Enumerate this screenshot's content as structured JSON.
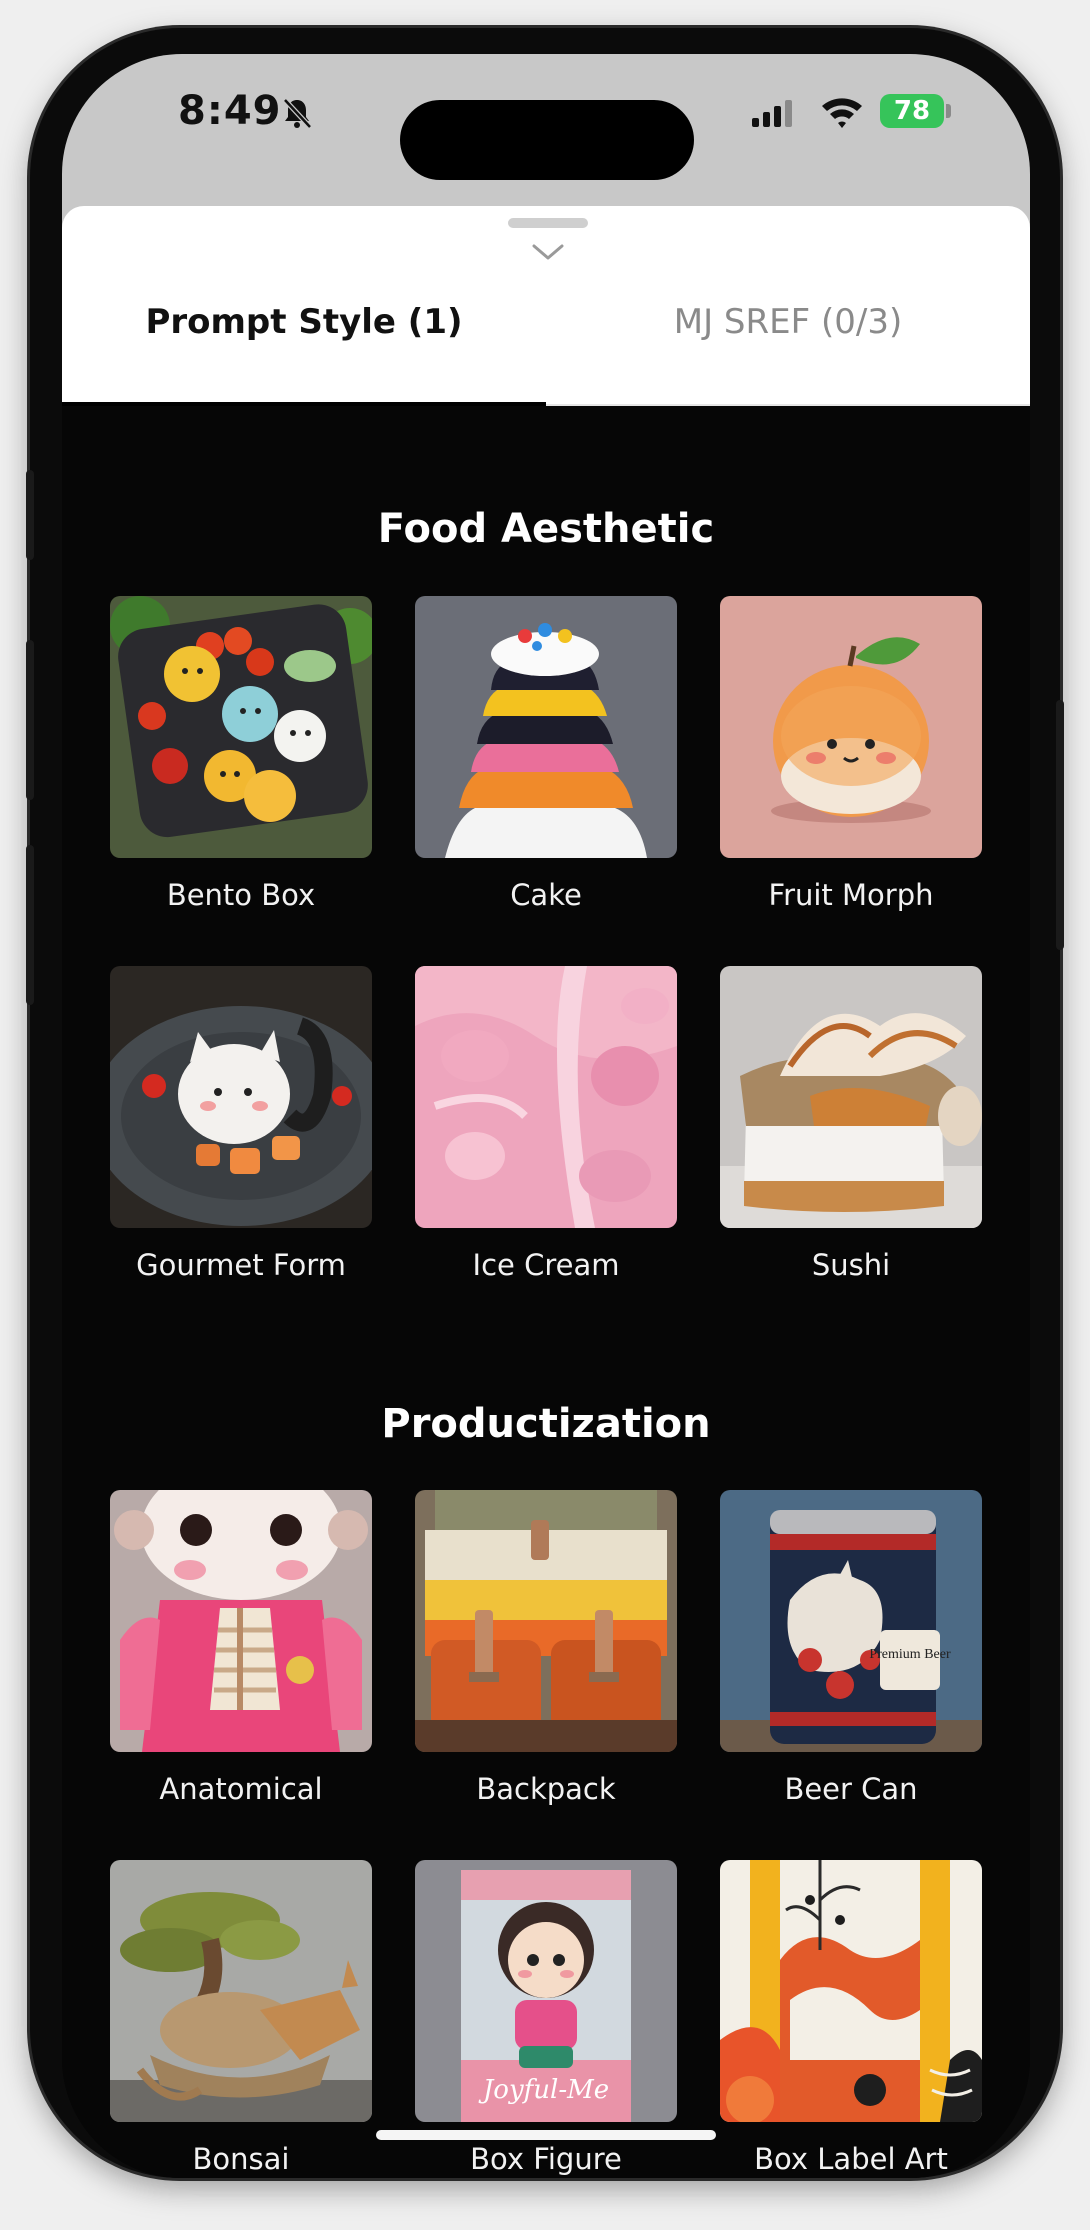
{
  "status_bar": {
    "time": "8:49",
    "battery": "78"
  },
  "tabs": [
    {
      "label": "Prompt Style (1)",
      "active": true
    },
    {
      "label": "MJ SREF (0/3)",
      "active": false
    }
  ],
  "sections": [
    {
      "title": "Food Aesthetic",
      "items": [
        {
          "label": "Bento Box"
        },
        {
          "label": "Cake"
        },
        {
          "label": "Fruit Morph"
        },
        {
          "label": "Gourmet Form"
        },
        {
          "label": "Ice Cream"
        },
        {
          "label": "Sushi"
        }
      ]
    },
    {
      "title": "Productization",
      "items": [
        {
          "label": "Anatomical"
        },
        {
          "label": "Backpack"
        },
        {
          "label": "Beer Can"
        },
        {
          "label": "Bonsai"
        },
        {
          "label": "Box Figure"
        },
        {
          "label": "Box Label Art"
        }
      ]
    }
  ],
  "image_text": {
    "beer_can": "Premium Beer",
    "box_figure": "Joyful-Me"
  }
}
